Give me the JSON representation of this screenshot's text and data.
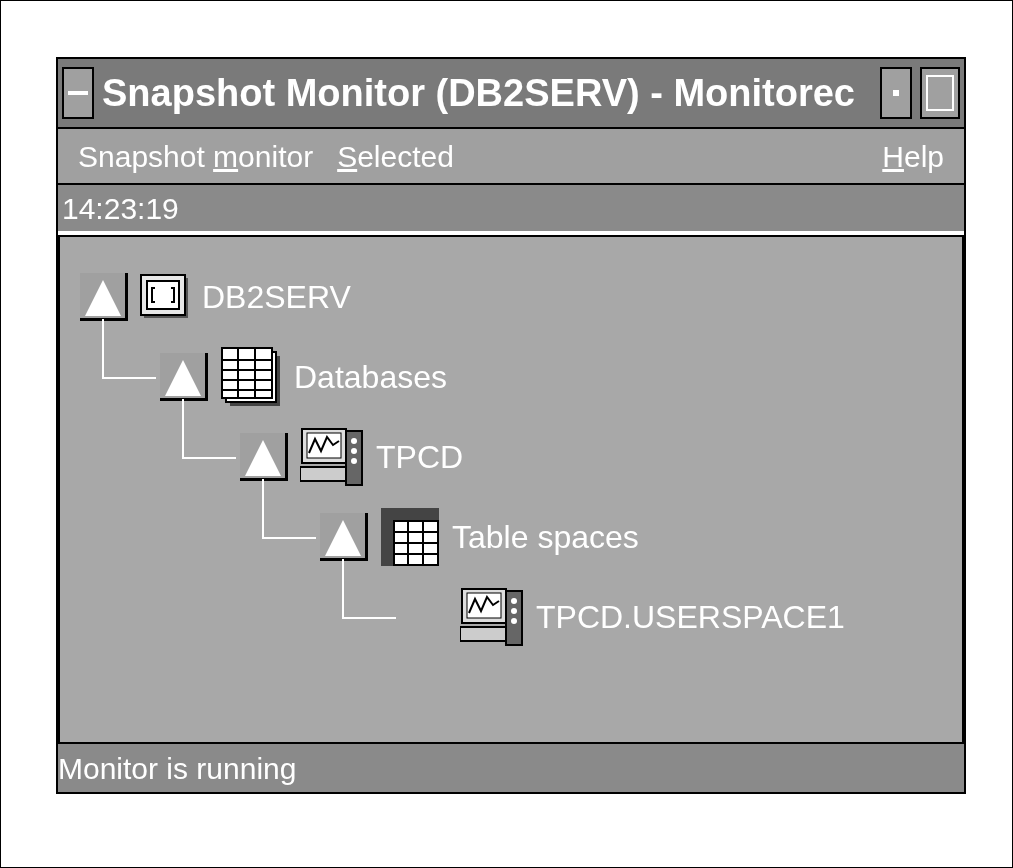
{
  "window": {
    "title": "Snapshot Monitor (DB2SERV) - Monitorec"
  },
  "menu": [
    {
      "before": "Snapshot ",
      "key": "m",
      "after": "onitor"
    },
    {
      "key": "S",
      "after": "elected"
    },
    {
      "key": "H",
      "after": "elp"
    }
  ],
  "time": "14:23:19",
  "tree": [
    {
      "label": "DB2SERV",
      "kind": "server",
      "expanded": true,
      "children": [
        {
          "label": "Databases",
          "kind": "stack",
          "expanded": true,
          "children": [
            {
              "label": "TPCD",
              "kind": "monitor",
              "expanded": true,
              "children": [
                {
                  "label": "Table spaces",
                  "kind": "table",
                  "expanded": true,
                  "children": [
                    {
                      "label": "TPCD.USERSPACE1",
                      "kind": "monitor"
                    }
                  ]
                }
              ]
            }
          ]
        }
      ]
    }
  ],
  "status_bar": "Monitor is running"
}
